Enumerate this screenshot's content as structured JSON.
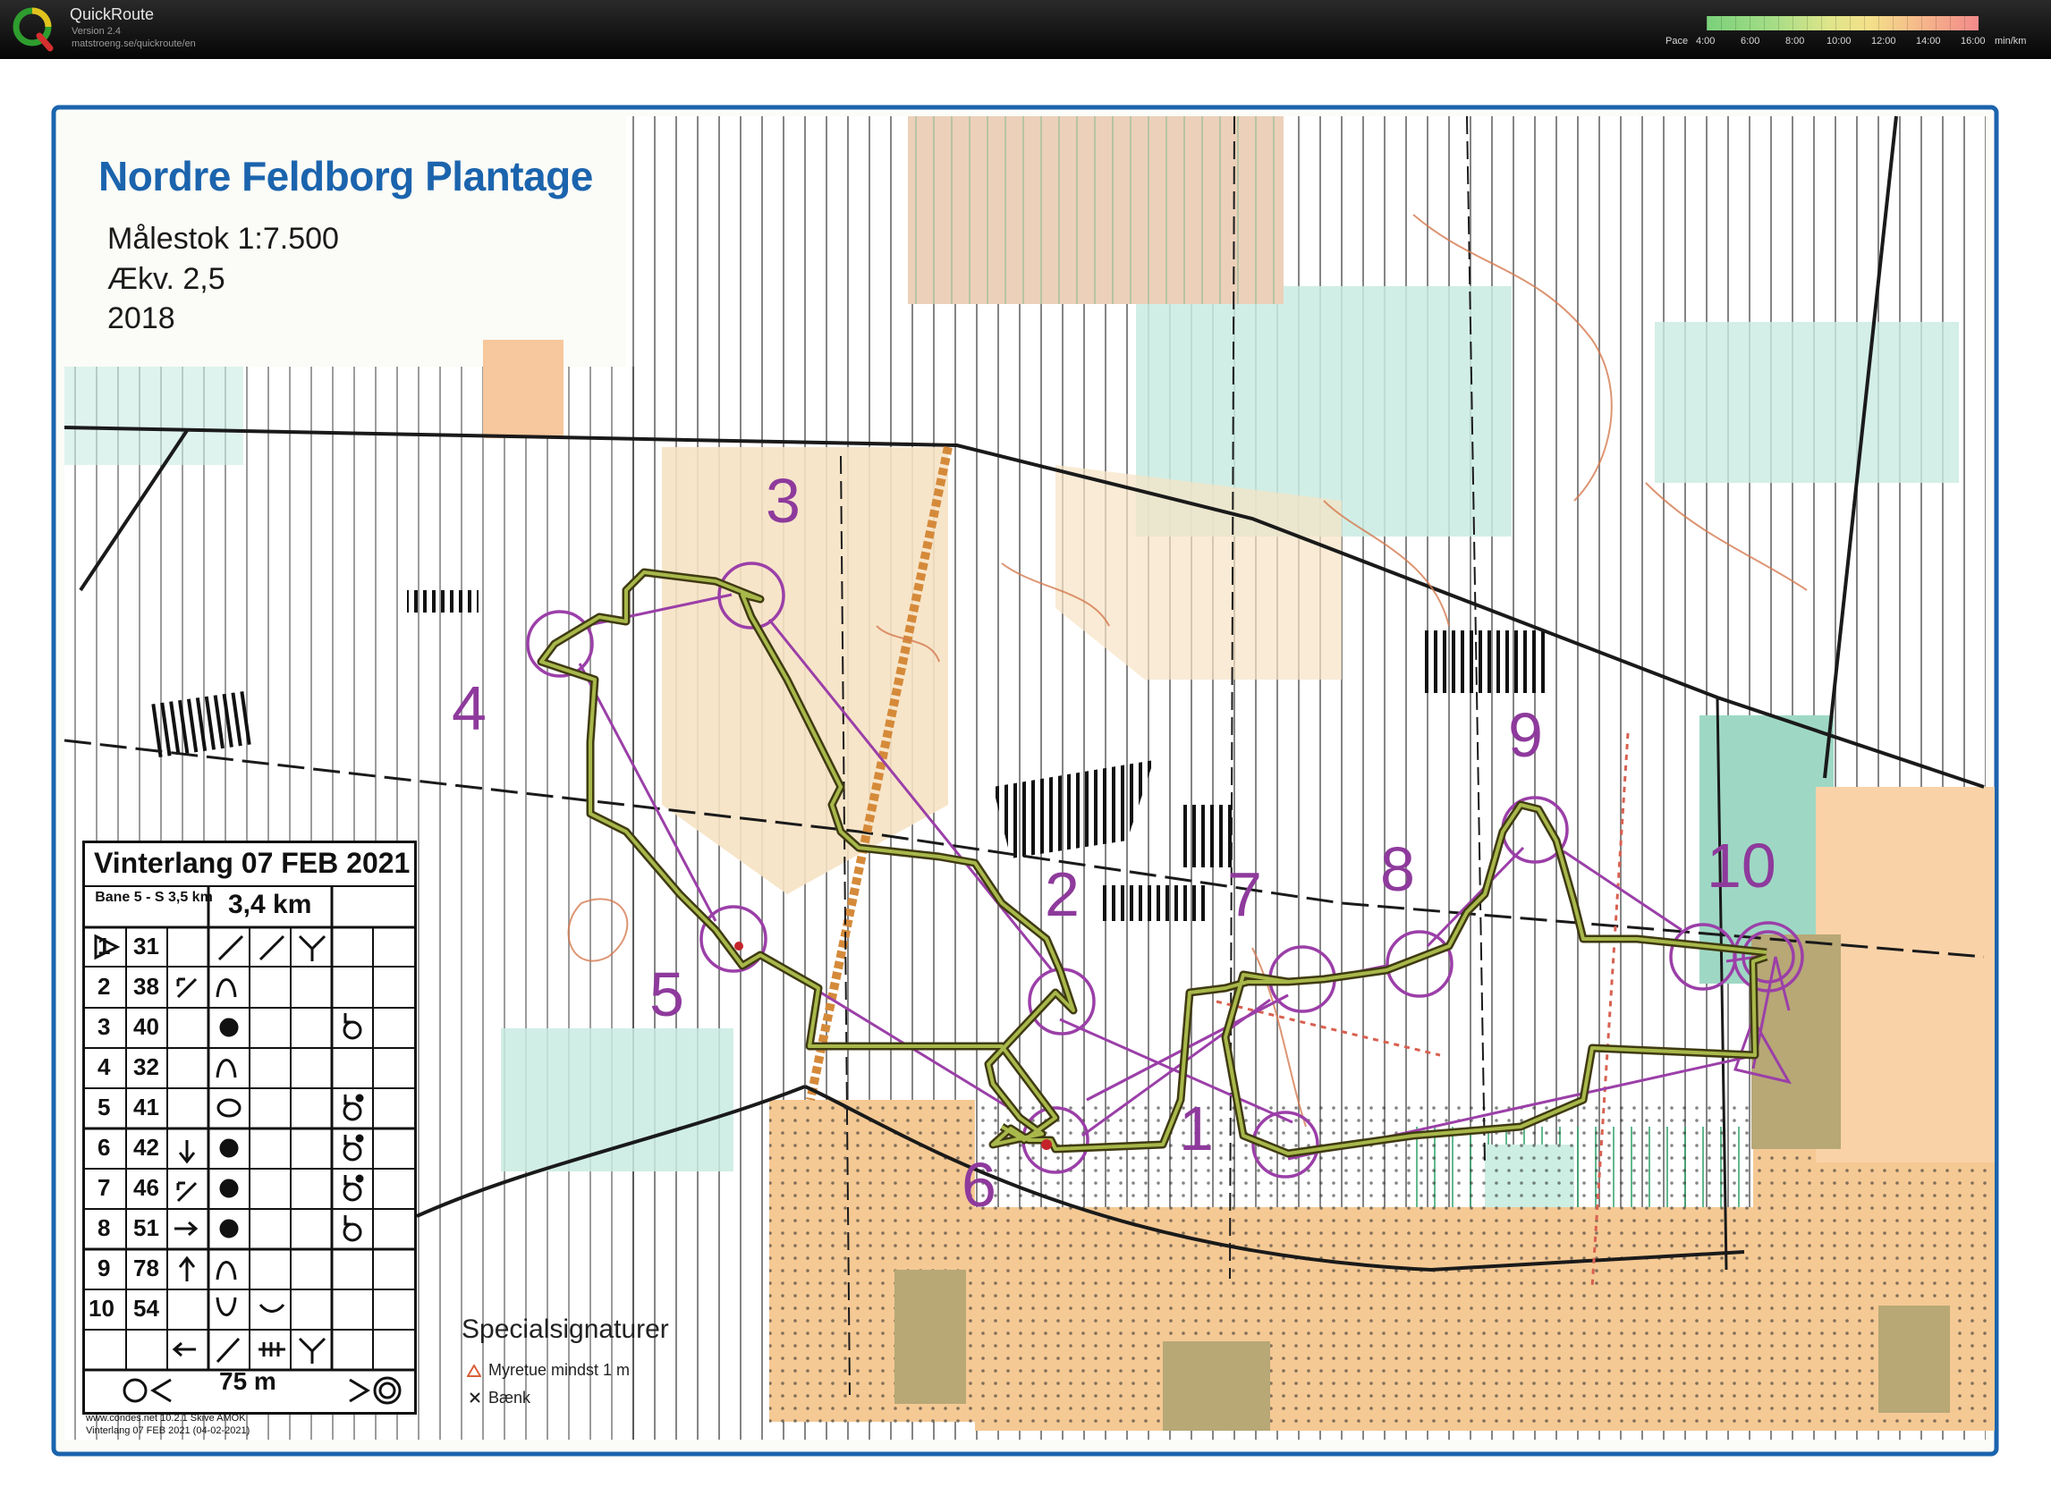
{
  "app": {
    "name": "QuickRoute",
    "version": "Version 2.4",
    "url": "matstroeng.se/quickroute/en"
  },
  "pace_scale": {
    "label": "Pace",
    "ticks": [
      "4:00",
      "6:00",
      "8:00",
      "10:00",
      "12:00",
      "14:00",
      "16:00"
    ],
    "unit": "min/km"
  },
  "map": {
    "title": "Nordre Feldborg Plantage",
    "scale": "Målestok 1:7.500",
    "contour": "Ækv. 2,5",
    "year": "2018",
    "controls": [
      {
        "label": "1"
      },
      {
        "label": "2"
      },
      {
        "label": "3"
      },
      {
        "label": "4"
      },
      {
        "label": "5"
      },
      {
        "label": "6"
      },
      {
        "label": "7"
      },
      {
        "label": "8"
      },
      {
        "label": "9"
      },
      {
        "label": "10"
      }
    ],
    "special": {
      "heading": "Specialsignaturer",
      "items": [
        "Myretue mindst 1 m",
        "Bænk"
      ]
    }
  },
  "course": {
    "title": "Vinterlang 07 FEB 2021",
    "bane": "Bane 5 - S 3,5 km",
    "distance": "3,4 km",
    "controls": [
      {
        "num": "1",
        "code": "31"
      },
      {
        "num": "2",
        "code": "38"
      },
      {
        "num": "3",
        "code": "40"
      },
      {
        "num": "4",
        "code": "32"
      },
      {
        "num": "5",
        "code": "41"
      },
      {
        "num": "6",
        "code": "42"
      },
      {
        "num": "7",
        "code": "46"
      },
      {
        "num": "8",
        "code": "51"
      },
      {
        "num": "9",
        "code": "78"
      },
      {
        "num": "10",
        "code": "54"
      }
    ],
    "finish_distance": "75 m",
    "credit_line1": "www.condes.net 10.2.1 Skive AMOK",
    "credit_line2": "Vinterlang 07 FEB 2021 (04-02-2021)"
  }
}
